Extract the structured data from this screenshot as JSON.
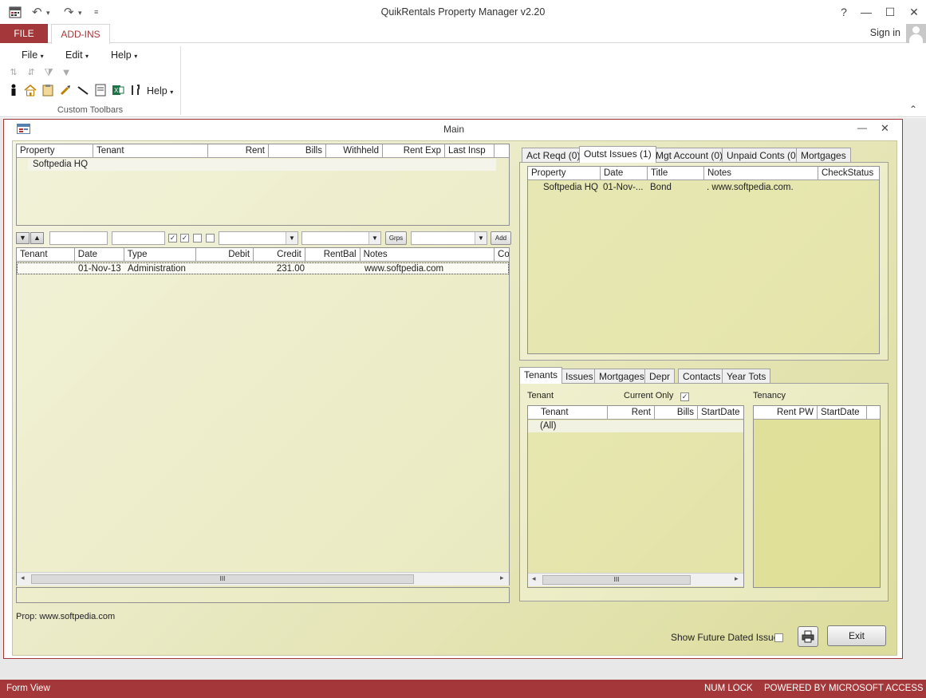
{
  "app": {
    "title": "QuikRentals Property Manager  v2.20",
    "help": "?",
    "minimize": "—",
    "maximize": "☐",
    "close": "✕"
  },
  "ribbon": {
    "tabs": [
      "FILE",
      "ADD-INS"
    ],
    "signin": "Sign in",
    "menus": [
      "File",
      "Edit",
      "Help"
    ],
    "toolbar_help": "Help",
    "group_label": "Custom Toolbars"
  },
  "mainwin": {
    "title": "Main",
    "minimize": "—",
    "close": "✕"
  },
  "property_list": {
    "columns": [
      "Property",
      "Tenant",
      "Rent",
      "Bills",
      "Withheld",
      "Rent Exp",
      "Last Insp"
    ],
    "rows": [
      [
        "Softpedia HQ",
        "",
        "",
        "",
        "",
        "",
        ""
      ]
    ]
  },
  "filter_bar": {
    "check1": "✓",
    "check2": "✓",
    "grps_label": "Grps",
    "add_label": "Add"
  },
  "transactions": {
    "columns": [
      "Tenant",
      "Date",
      "Type",
      "Debit",
      "Credit",
      "RentBal",
      "Notes",
      "Cor"
    ],
    "rows": [
      [
        "",
        "01-Nov-13",
        "Administration",
        "",
        "231.00",
        "",
        "www.softpedia.com"
      ]
    ]
  },
  "prop_status": "Prop: www.softpedia.com",
  "issue_tabs": [
    "Act Reqd (0)",
    "Outst Issues (1)",
    "Mgt Account (0)",
    "Unpaid Conts (0)",
    "Mortgages"
  ],
  "issues": {
    "columns": [
      "Property",
      "Date",
      "Title",
      "Notes",
      "CheckStatus"
    ],
    "rows": [
      [
        "Softpedia HQ",
        "01-Nov-...",
        "Bond",
        ". www.softpedia.com.",
        ""
      ]
    ]
  },
  "tenant_tabs": [
    "Tenants",
    "Issues",
    "Mortgages",
    "Depr",
    "Contacts",
    "Year Tots"
  ],
  "tenants": {
    "tenant_label": "Tenant",
    "current_only_label": "Current Only",
    "current_only_check": "✓",
    "tenancy_label": "Tenancy",
    "columns": [
      "Tenant",
      "Rent",
      "Bills",
      "StartDate"
    ],
    "rows": [
      [
        "(All)",
        "",
        "",
        ""
      ]
    ],
    "tenancy_columns": [
      "Rent PW",
      "StartDate"
    ]
  },
  "footer": {
    "show_future_label": "Show Future Dated Issues",
    "exit_label": "Exit"
  },
  "scrollbar": {
    "grip": "III",
    "left": "◂",
    "right": "▸"
  },
  "statusbar": {
    "left": "Form View",
    "numlock": "NUM LOCK",
    "powered": "POWERED BY MICROSOFT ACCESS"
  },
  "colors": {
    "accent": "#a4373a"
  }
}
